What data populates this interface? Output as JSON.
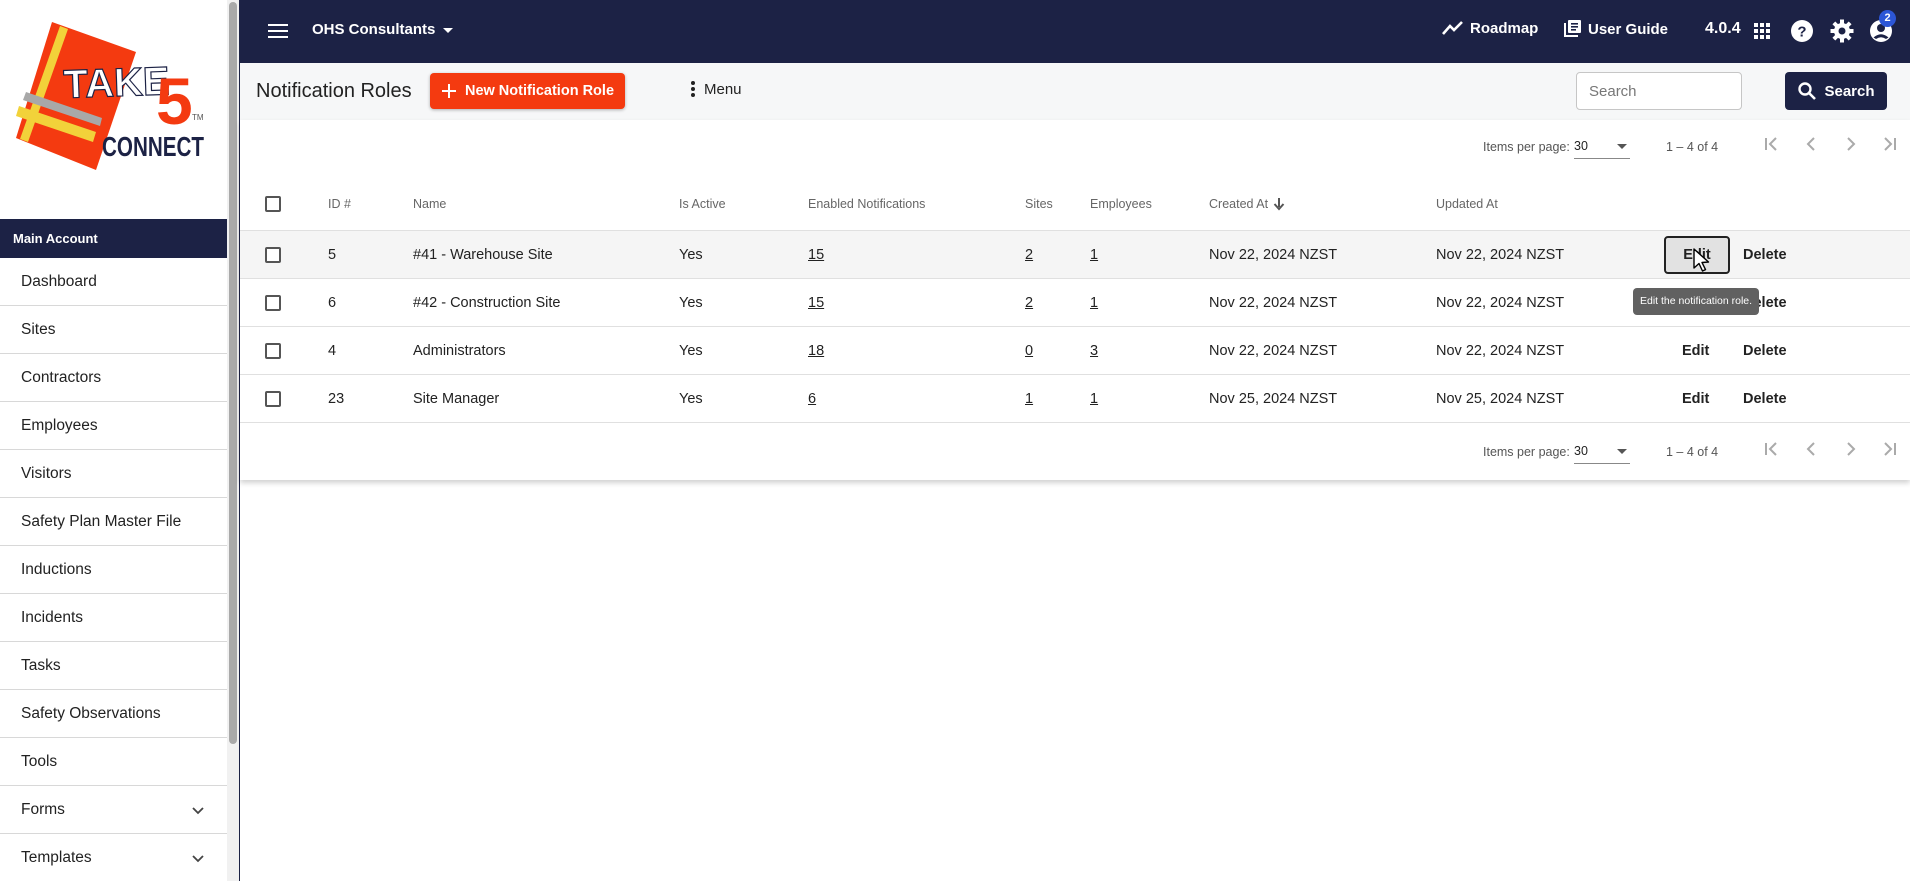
{
  "logo": {
    "text_top": "TAKE",
    "text_num": "5",
    "text_bottom": "CONNECT",
    "tm": "TM"
  },
  "sidebar": {
    "account_label": "Main Account",
    "items": [
      {
        "label": "Dashboard",
        "expandable": false
      },
      {
        "label": "Sites",
        "expandable": false
      },
      {
        "label": "Contractors",
        "expandable": false
      },
      {
        "label": "Employees",
        "expandable": false
      },
      {
        "label": "Visitors",
        "expandable": false
      },
      {
        "label": "Safety Plan Master File",
        "expandable": false
      },
      {
        "label": "Inductions",
        "expandable": false
      },
      {
        "label": "Incidents",
        "expandable": false
      },
      {
        "label": "Tasks",
        "expandable": false
      },
      {
        "label": "Safety Observations",
        "expandable": false
      },
      {
        "label": "Tools",
        "expandable": false
      },
      {
        "label": "Forms",
        "expandable": true
      },
      {
        "label": "Templates",
        "expandable": true
      }
    ]
  },
  "topbar": {
    "org_name": "OHS Consultants",
    "roadmap_label": "Roadmap",
    "user_guide_label": "User Guide",
    "version": "4.0.4",
    "notification_count": "2"
  },
  "toolbar": {
    "title": "Notification Roles",
    "new_button_label": "New Notification Role",
    "menu_label": "Menu",
    "search_placeholder": "Search",
    "search_button_label": "Search"
  },
  "paginator": {
    "items_per_page_label": "Items per page:",
    "items_per_page_value": "30",
    "range_label": "1 – 4 of 4"
  },
  "table": {
    "columns": {
      "id": "ID #",
      "name": "Name",
      "is_active": "Is Active",
      "enabled_notifications": "Enabled Notifications",
      "sites": "Sites",
      "employees": "Employees",
      "created_at": "Created At",
      "updated_at": "Updated At"
    },
    "rows": [
      {
        "id": "5",
        "name": "#41 - Warehouse Site",
        "is_active": "Yes",
        "enabled_notifications": "15",
        "sites": "2",
        "employees": "1",
        "created_at": "Nov 22, 2024 NZST",
        "updated_at": "Nov 22, 2024 NZST"
      },
      {
        "id": "6",
        "name": "#42 - Construction Site",
        "is_active": "Yes",
        "enabled_notifications": "15",
        "sites": "2",
        "employees": "1",
        "created_at": "Nov 22, 2024 NZST",
        "updated_at": "Nov 22, 2024 NZST"
      },
      {
        "id": "4",
        "name": "Administrators",
        "is_active": "Yes",
        "enabled_notifications": "18",
        "sites": "0",
        "employees": "3",
        "created_at": "Nov 22, 2024 NZST",
        "updated_at": "Nov 22, 2024 NZST"
      },
      {
        "id": "23",
        "name": "Site Manager",
        "is_active": "Yes",
        "enabled_notifications": "6",
        "sites": "1",
        "employees": "1",
        "created_at": "Nov 25, 2024 NZST",
        "updated_at": "Nov 25, 2024 NZST"
      }
    ],
    "edit_label": "Edit",
    "delete_label": "Delete",
    "tooltip": "Edit the notification role."
  },
  "colors": {
    "navy": "#1c2245",
    "accent": "#f43a10",
    "badge": "#2c56d6"
  }
}
